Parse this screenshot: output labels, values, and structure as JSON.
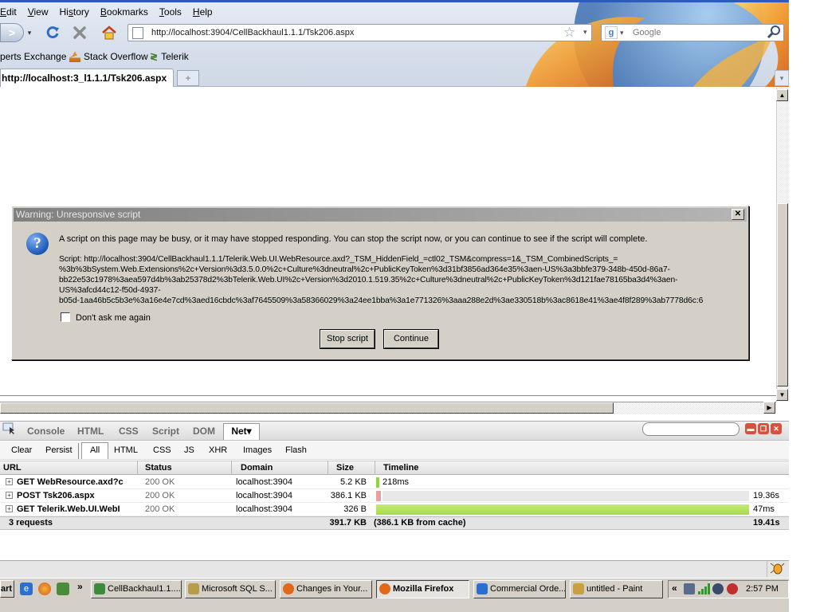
{
  "menu": {
    "items": [
      "Edit",
      "View",
      "History",
      "Bookmarks",
      "Tools",
      "Help"
    ],
    "access_keys": [
      "E",
      "V",
      "s",
      "B",
      "T",
      "H"
    ]
  },
  "nav": {
    "url": "http://localhost:3904/CellBackhaul1.1.1/Tsk206.aspx",
    "search_placeholder": "Google"
  },
  "bookmarks": [
    "perts Exchange",
    "Stack Overflow",
    "Telerik"
  ],
  "tab": {
    "title": "http://localhost:3_l1.1.1/Tsk206.aspx",
    "new_tab": "+"
  },
  "dialog": {
    "title": "Warning: Unresponsive script",
    "message": "A script on this page may be busy, or it may have stopped responding. You can stop the script now, or you can continue to see if the script will complete.",
    "script_lines": [
      "Script: http://localhost:3904/CellBackhaul1.1.1/Telerik.Web.UI.WebResource.axd?_TSM_HiddenField_=ctl02_TSM&compress=1&_TSM_CombinedScripts_=",
      "%3b%3bSystem.Web.Extensions%2c+Version%3d3.5.0.0%2c+Culture%3dneutral%2c+PublicKeyToken%3d31bf3856ad364e35%3aen-US%3a3bbfe379-348b-450d-86a7-",
      "bb22e53c1978%3aea597d4b%3ab25378d2%3bTelerik.Web.UI%2c+Version%3d2010.1.519.35%2c+Culture%3dneutral%2c+PublicKeyToken%3d121fae78165ba3d4%3aen-",
      "US%3afcd44c12-f50d-4937-",
      "b05d-1aa46b5c5b3e%3a16e4e7cd%3aed16cbdc%3af7645509%3a58366029%3a24ee1bba%3a1e771326%3aaa288e2d%3ae330518b%3ac8618e41%3ae4f8f289%3ab7778d6c:6"
    ],
    "checkbox_label": "Don't ask me again",
    "checkbox_checked": false,
    "stop_button": "Stop script",
    "continue_button": "Continue",
    "icon": "question-icon"
  },
  "firebug": {
    "tabs": [
      "Console",
      "HTML",
      "CSS",
      "Script",
      "DOM"
    ],
    "active_tab": "Net▾",
    "subtoolbar": [
      "Clear",
      "Persist",
      "All",
      "HTML",
      "CSS",
      "JS",
      "XHR",
      "Images",
      "Flash"
    ],
    "columns": [
      "URL",
      "Status",
      "Domain",
      "Size",
      "Timeline"
    ],
    "rows": [
      {
        "url": "GET WebResource.axd?c",
        "status": "200 OK",
        "domain": "localhost:3904",
        "size": "5.2 KB",
        "time_label": "218ms",
        "time_right": "",
        "bar_start": 0.0,
        "bar_width": 0.008,
        "bar_color": "#8fd43b"
      },
      {
        "url": "POST Tsk206.aspx",
        "status": "200 OK",
        "domain": "localhost:3904",
        "size": "386.1 KB",
        "time_label": "",
        "time_right": "19.36s",
        "bar_start": 0.0,
        "bar_width": 1.0,
        "bar_color": "#e8e8e8"
      },
      {
        "url": "GET Telerik.Web.UI.WebI",
        "status": "200 OK",
        "domain": "localhost:3904",
        "size": "326 B",
        "time_label": "",
        "time_right": "47ms",
        "bar_start": 0.0,
        "bar_width": 1.0,
        "bar_color": "#a8d94a"
      }
    ],
    "summary": {
      "requests": "3 requests",
      "size": "391.7 KB",
      "cache": "(386.1 KB from cache)",
      "total": "19.41s"
    }
  },
  "taskbar": {
    "start": "art",
    "tasks": [
      {
        "label": "CellBackhaul1.1....",
        "active": false,
        "color": "#3c8a3c"
      },
      {
        "label": "Microsoft SQL S...",
        "active": false,
        "color": "#b89c4a"
      },
      {
        "label": "Changes in Your...",
        "active": false,
        "color": "#e06a1a"
      },
      {
        "label": "Mozilla Firefox",
        "active": true,
        "color": "#e06a1a"
      },
      {
        "label": "Commercial Orde...",
        "active": false,
        "color": "#2a6fd0"
      },
      {
        "label": "untitled - Paint",
        "active": false,
        "color": "#c8a040"
      }
    ],
    "tray_expand": "«",
    "clock": "2:57 PM"
  }
}
